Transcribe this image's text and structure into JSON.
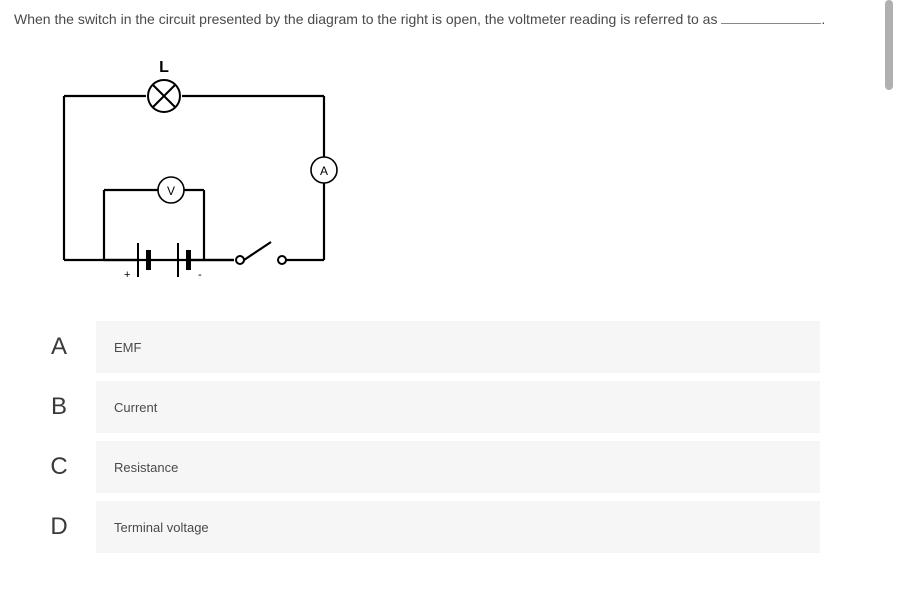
{
  "question": {
    "text_before": "When the switch in the circuit presented by the diagram to the right is open, the voltmeter reading is referred to as ",
    "text_after": "."
  },
  "diagram": {
    "lamp_label": "L",
    "voltmeter_label": "V",
    "ammeter_label": "A",
    "polarity_plus": "+",
    "polarity_minus": "-"
  },
  "options": [
    {
      "letter": "A",
      "text": "EMF"
    },
    {
      "letter": "B",
      "text": "Current"
    },
    {
      "letter": "C",
      "text": "Resistance"
    },
    {
      "letter": "D",
      "text": "Terminal voltage"
    }
  ]
}
